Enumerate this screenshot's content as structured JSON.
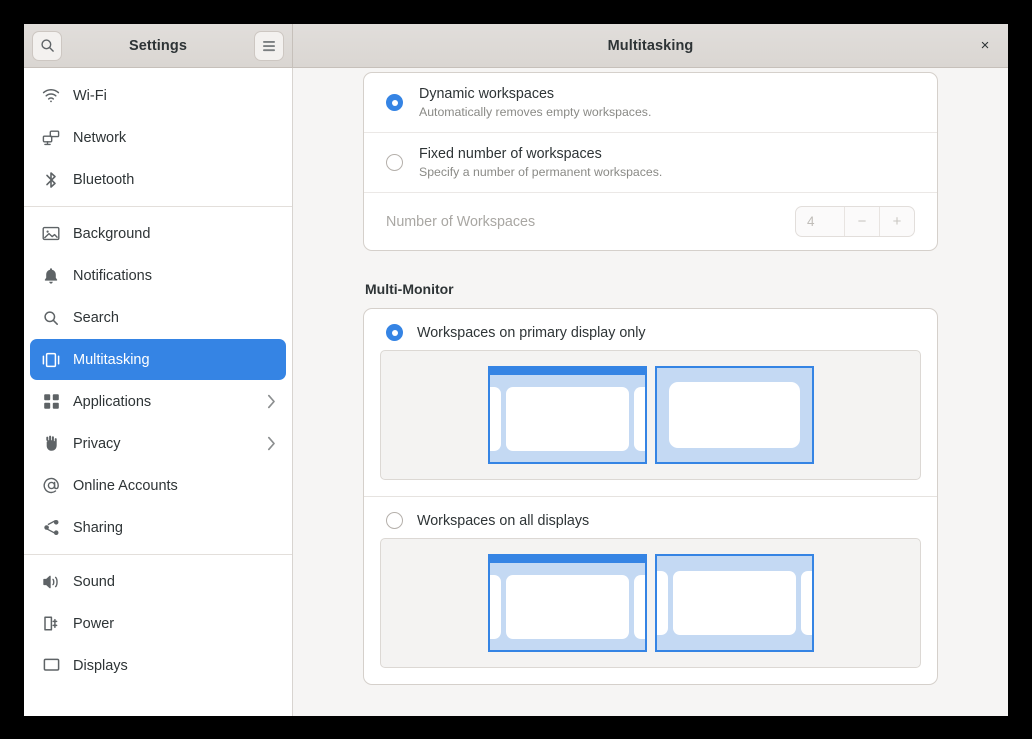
{
  "window": {
    "sidebar_title": "Settings",
    "main_title": "Multitasking",
    "close_label": "×",
    "search_icon": "search-icon",
    "menu_icon": "hamburger-menu-icon"
  },
  "sidebar": {
    "items": [
      {
        "label": "Wi-Fi",
        "icon": "wifi-icon",
        "selected": false,
        "chevron": false
      },
      {
        "label": "Network",
        "icon": "network-icon",
        "selected": false,
        "chevron": false
      },
      {
        "label": "Bluetooth",
        "icon": "bluetooth-icon",
        "selected": false,
        "chevron": false
      },
      {
        "label": "Background",
        "icon": "background-image-icon",
        "selected": false,
        "chevron": false
      },
      {
        "label": "Notifications",
        "icon": "bell-icon",
        "selected": false,
        "chevron": false
      },
      {
        "label": "Search",
        "icon": "search-icon",
        "selected": false,
        "chevron": false
      },
      {
        "label": "Multitasking",
        "icon": "multitasking-icon",
        "selected": true,
        "chevron": false
      },
      {
        "label": "Applications",
        "icon": "apps-grid-icon",
        "selected": false,
        "chevron": true
      },
      {
        "label": "Privacy",
        "icon": "hand-icon",
        "selected": false,
        "chevron": true
      },
      {
        "label": "Online Accounts",
        "icon": "at-sign-icon",
        "selected": false,
        "chevron": false
      },
      {
        "label": "Sharing",
        "icon": "share-nodes-icon",
        "selected": false,
        "chevron": false
      },
      {
        "label": "Sound",
        "icon": "speaker-icon",
        "selected": false,
        "chevron": false
      },
      {
        "label": "Power",
        "icon": "battery-icon",
        "selected": false,
        "chevron": false
      },
      {
        "label": "Displays",
        "icon": "display-icon",
        "selected": false,
        "chevron": false
      }
    ]
  },
  "main": {
    "workspaces": {
      "dynamic": {
        "title": "Dynamic workspaces",
        "subtitle": "Automatically removes empty workspaces.",
        "selected": true
      },
      "fixed": {
        "title": "Fixed number of workspaces",
        "subtitle": "Specify a number of permanent workspaces.",
        "selected": false
      },
      "number_row": {
        "label": "Number of Workspaces",
        "value": "4",
        "decrement_label": "−",
        "increment_label": "+",
        "disabled": true
      }
    },
    "multi_monitor": {
      "section_title": "Multi-Monitor",
      "primary_only": {
        "label": "Workspaces on primary display only",
        "selected": true
      },
      "all_displays": {
        "label": "Workspaces on all displays",
        "selected": false
      }
    }
  },
  "colors": {
    "accent": "#3584e4",
    "monitor_fill": "#c4d9f3",
    "header_bg": "#dad6d2",
    "content_bg": "#f6f5f4"
  }
}
